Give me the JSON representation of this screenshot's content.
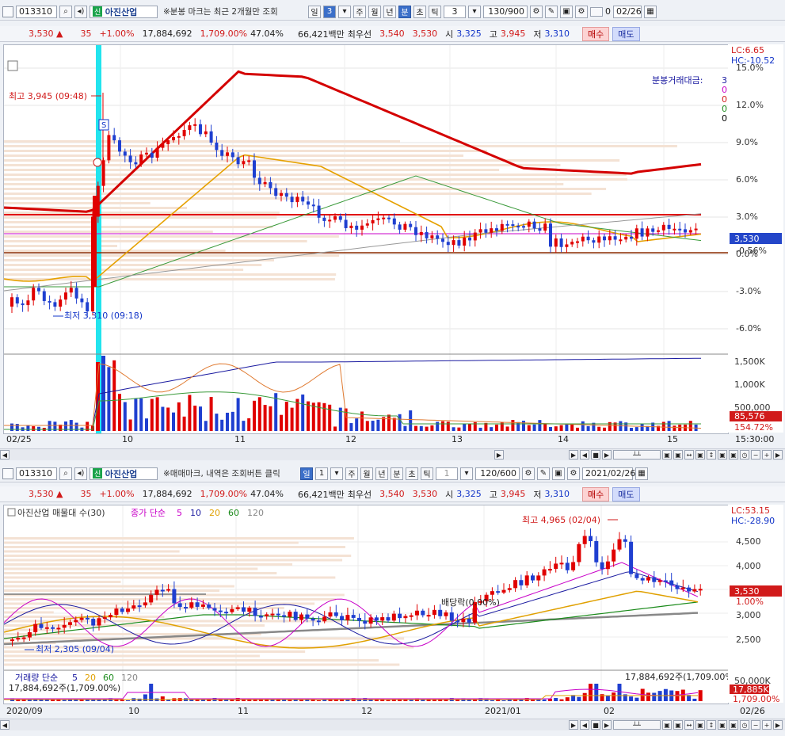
{
  "top": {
    "toolbar": {
      "code": "013310",
      "tag": "신",
      "name": "아진산업",
      "hint": "※분봉 마크는 최근 2개월만 조회",
      "periods": [
        "일",
        "3",
        "주",
        "월",
        "년",
        "분",
        "초",
        "틱"
      ],
      "interval": "3",
      "count": "130/900",
      "checkbox_label": "0",
      "date": "02/26"
    },
    "quote": {
      "price": "3,530",
      "arrow": "▲",
      "change": "35",
      "pct": "+1.00%",
      "volume": "17,884,692",
      "vol_ratio": "1,709.00%",
      "turnover": "47.04%",
      "amount": "66,421백만",
      "best_label": "최우선",
      "ask": "3,540",
      "bid": "3,530",
      "open_label": "시",
      "open": "3,325",
      "high_label": "고",
      "high": "3,945",
      "low_label": "저",
      "low": "3,310",
      "buy": "매수",
      "sell": "매도"
    },
    "chart": {
      "lc": "LC:6.65",
      "hc": "HC:-10.52",
      "legend_title": "분봉거래대금:",
      "legend_vals": [
        "3",
        "0",
        "0",
        "0",
        "0"
      ],
      "legend_colors": [
        "#1a1aa0",
        "#c800c8",
        "#d11a1a",
        "#1a8a1a",
        "#000000"
      ],
      "high_note": "최고 3,945 (09:48)",
      "low_note": "최저 3,310 (09:18)",
      "price_tag": "3,530",
      "pct_tag": "-0.56%",
      "y_ticks": [
        "15.0%",
        "12.0%",
        "9.0%",
        "6.0%",
        "3.0%",
        "0.0%",
        "-3.0%",
        "-6.0%"
      ],
      "vol_ticks": [
        "1,500K",
        "1,000K",
        "500,000"
      ],
      "vol_tag1": "85,576",
      "vol_tag2": "154.72%",
      "x_ticks": [
        "02/25",
        "10",
        "11",
        "12",
        "13",
        "14",
        "15",
        "15:30:00"
      ]
    }
  },
  "bottom": {
    "toolbar": {
      "code": "013310",
      "tag": "신",
      "name": "아진산업",
      "hint": "※매매마크, 내역은 조회버튼 클릭",
      "periods": [
        "일",
        "1",
        "주",
        "월",
        "년",
        "분",
        "초",
        "틱"
      ],
      "interval": "1",
      "count": "120/600",
      "date": "2021/02/26"
    },
    "quote": {
      "price": "3,530",
      "arrow": "▲",
      "change": "35",
      "pct": "+1.00%",
      "volume": "17,884,692",
      "vol_ratio": "1,709.00%",
      "turnover": "47.04%",
      "amount": "66,421백만",
      "best_label": "최우선",
      "ask": "3,540",
      "bid": "3,530",
      "open_label": "시",
      "open": "3,325",
      "high_label": "고",
      "high": "3,945",
      "low_label": "저",
      "low": "3,310",
      "buy": "매수",
      "sell": "매도"
    },
    "chart": {
      "title": "아진산업 매물대 수(30)",
      "ma_label": "종가 단순",
      "ma_vals": [
        "5",
        "10",
        "20",
        "60",
        "120"
      ],
      "ma_colors": [
        "#c800c8",
        "#1a1aa0",
        "#e0a000",
        "#1a8a1a",
        "#888888"
      ],
      "lc": "LC:53.15",
      "hc": "HC:-28.90",
      "high_note": "최고 4,965 (02/04)",
      "low_note": "최저 2,305 (09/04)",
      "div_note": "배당락(0.00%)",
      "price_tag": "3,530",
      "pct_tag": "1.00%",
      "y_ticks": [
        "4,500",
        "4,000",
        "3,500",
        "3,000",
        "2,500"
      ],
      "vol_label": "거래량 단순",
      "vol_ma": [
        "5",
        "20",
        "60",
        "120"
      ],
      "vol_ma_colors": [
        "#1a1aa0",
        "#e0a000",
        "#1a8a1a",
        "#888888"
      ],
      "vol_note_left": "17,884,692주(1,709.00%)",
      "vol_note_right": "17,884,692주(1,709.00%)",
      "vol_ticks": [
        "50,000K"
      ],
      "vol_tag1": "17,885K",
      "vol_tag2": "1,709.00%",
      "x_ticks": [
        "2020/09",
        "10",
        "11",
        "12",
        "2021/01",
        "02",
        "02/26"
      ]
    }
  }
}
